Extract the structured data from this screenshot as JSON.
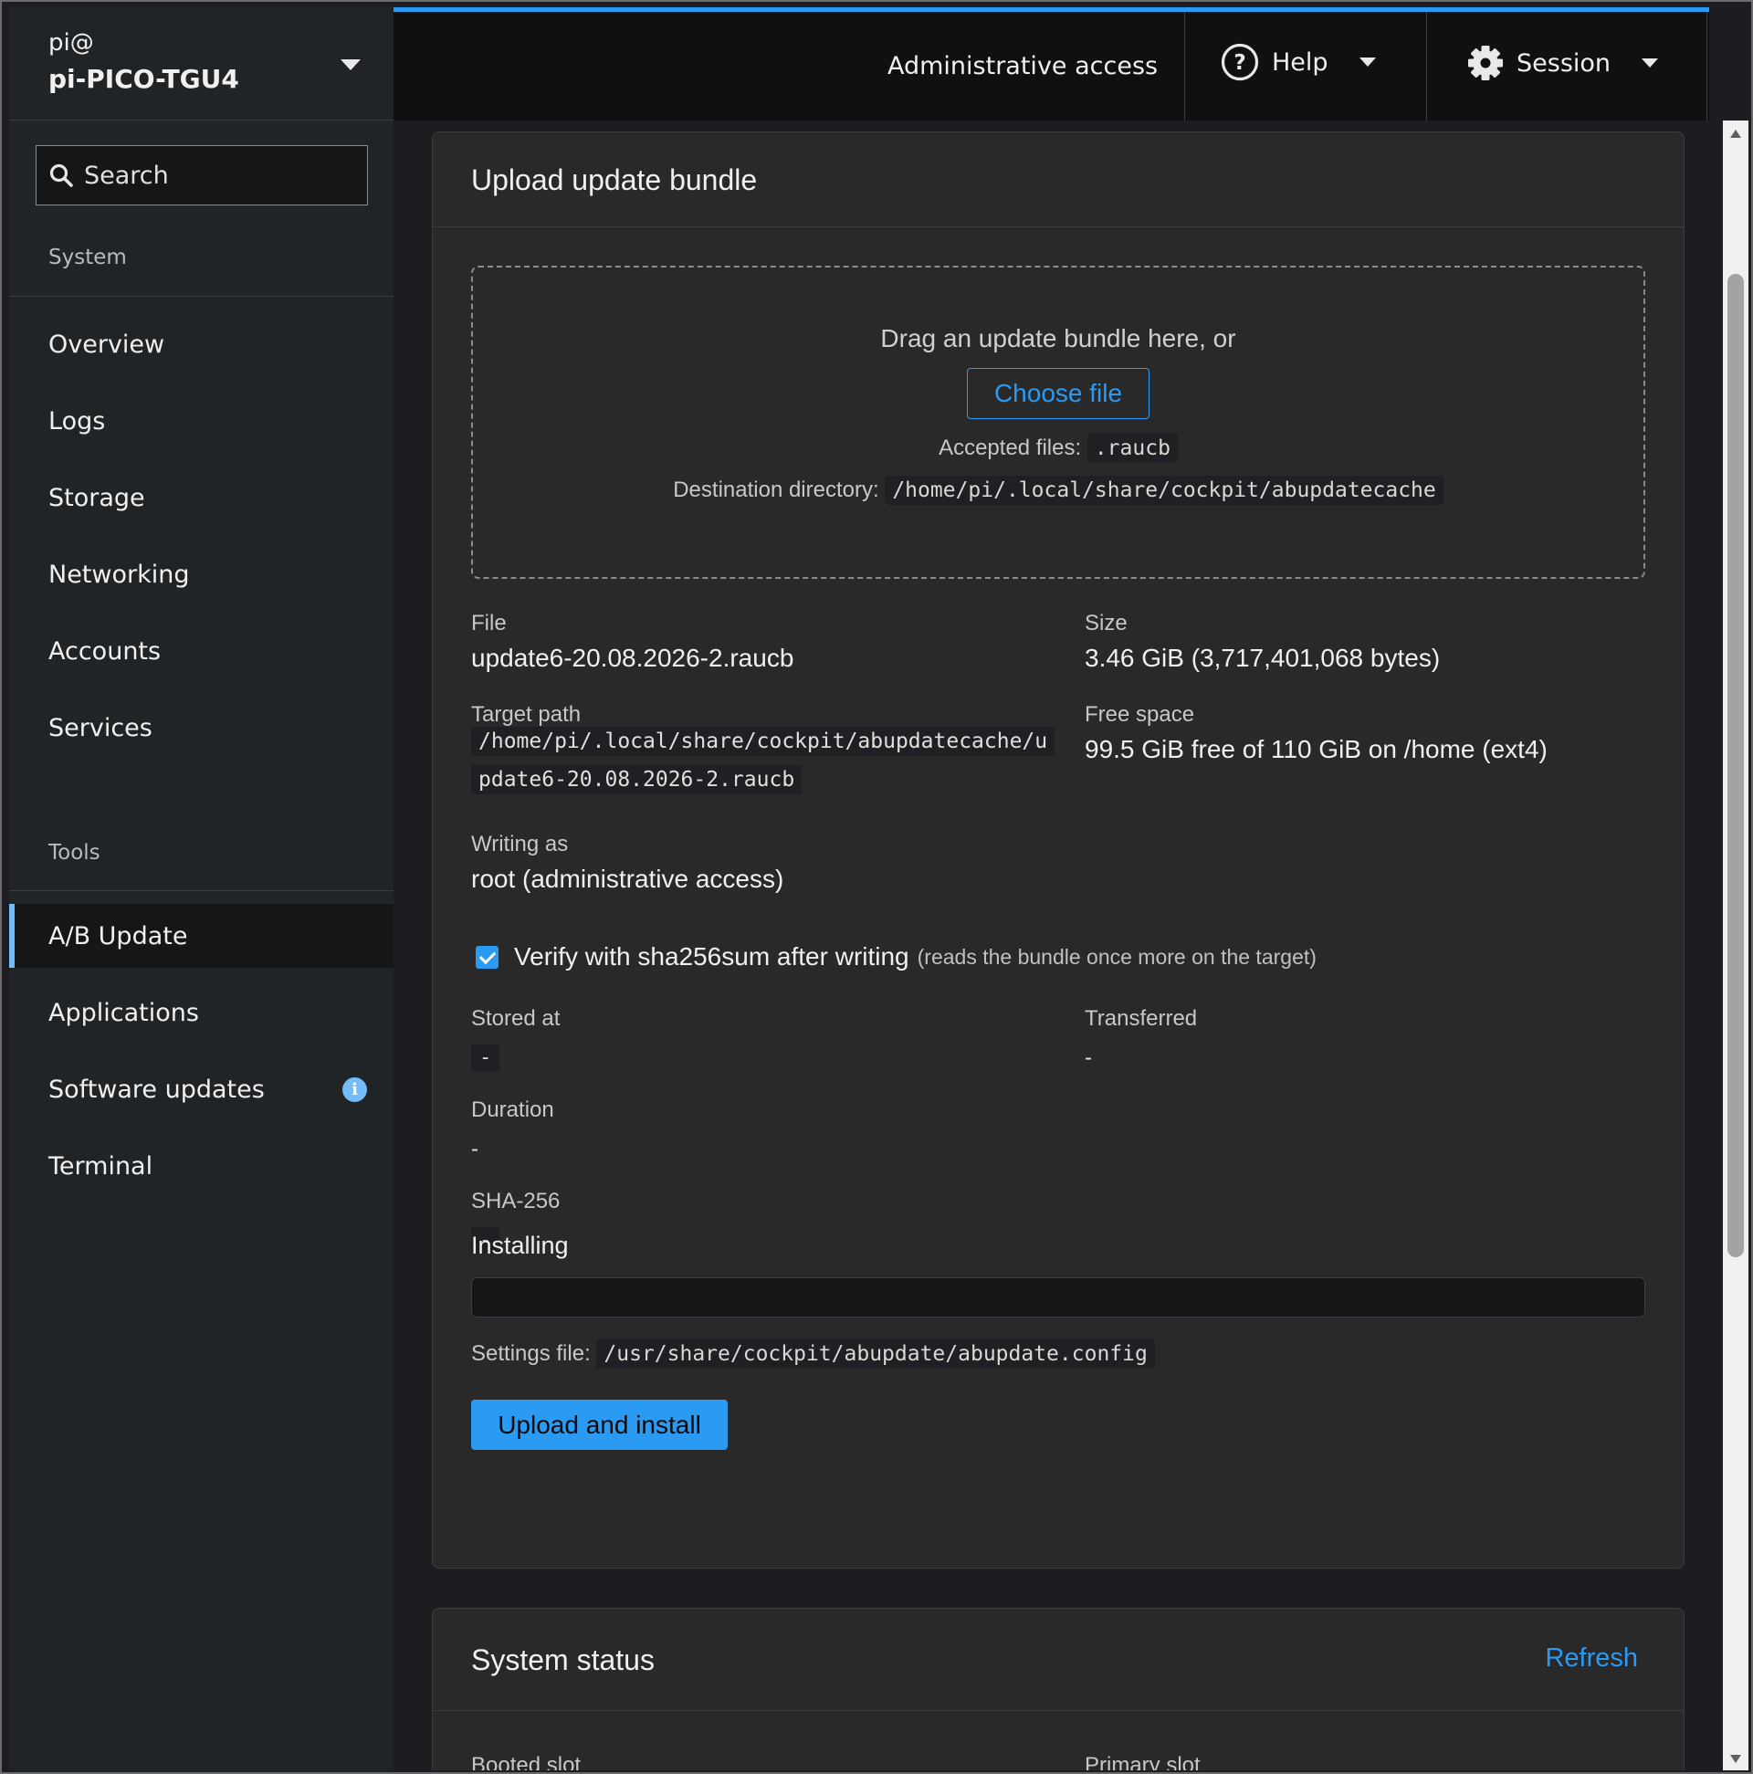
{
  "host": {
    "user": "pi@",
    "name": "pi-PICO-TGU4"
  },
  "search": {
    "placeholder": "Search"
  },
  "nav": {
    "system_label": "System",
    "system_items": [
      "Overview",
      "Logs",
      "Storage",
      "Networking",
      "Accounts",
      "Services"
    ],
    "tools_label": "Tools",
    "tools_items": [
      "A/B Update",
      "Applications",
      "Software updates",
      "Terminal"
    ],
    "active_item": "A/B Update"
  },
  "topbar": {
    "admin": "Administrative access",
    "help": "Help",
    "session": "Session"
  },
  "upload": {
    "title": "Upload update bundle",
    "drag_text": "Drag an update bundle here, or",
    "choose_button": "Choose file",
    "accepted_label": "Accepted files:",
    "accepted_value": ".raucb",
    "dest_label": "Destination directory:",
    "dest_value": "/home/pi/.local/share/cockpit/abupdatecache",
    "file_label": "File",
    "file_value": "update6-20.08.2026-2.raucb",
    "size_label": "Size",
    "size_value": "3.46 GiB (3,717,401,068 bytes)",
    "target_label": "Target path",
    "target_line1": "/home/pi/.local/share/cockpit/abupdatecache/u",
    "target_line2": "pdate6-20.08.2026-2.raucb",
    "free_label": "Free space",
    "free_value": "99.5 GiB free of 110 GiB on /home (ext4)",
    "writing_label": "Writing as",
    "writing_value": "root (administrative access)",
    "verify_checked": true,
    "verify_label": "Verify with sha256sum after writing",
    "verify_hint": "(reads the bundle once more on the target)",
    "stored_label": "Stored at",
    "stored_value": "-",
    "transferred_label": "Transferred",
    "transferred_value": "-",
    "duration_label": "Duration",
    "duration_value": "-",
    "sha_label": "SHA-256",
    "sha_value": "-",
    "installing_label": "Installing",
    "progress": 0,
    "settings_label": "Settings file:",
    "settings_value": "/usr/share/cockpit/abupdate/abupdate.config",
    "upload_button": "Upload and install"
  },
  "status": {
    "title": "System status",
    "refresh": "Refresh",
    "booted_label": "Booted slot",
    "primary_label": "Primary slot"
  },
  "colors": {
    "accent": "#2b9af3",
    "active_bar": "#73bcf7",
    "background": "#1b1d21",
    "card": "#292929"
  }
}
